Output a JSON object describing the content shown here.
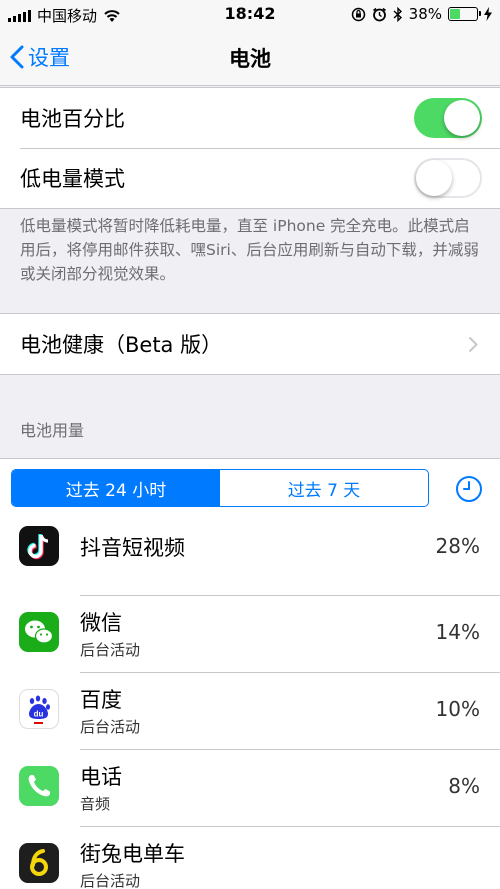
{
  "status_bar": {
    "carrier": "中国移动",
    "time": "18:42",
    "battery_percent": "38%",
    "battery_level": 0.38
  },
  "nav": {
    "back_label": "设置",
    "title": "电池"
  },
  "settings": {
    "battery_percentage_label": "电池百分比",
    "battery_percentage_on": true,
    "low_power_label": "低电量模式",
    "low_power_on": false,
    "low_power_footnote": "低电量模式将暂时降低耗电量，直至 iPhone 完全充电。此模式启用后，将停用邮件获取、嘿Siri、后台应用刷新与自动下载，并减弱或关闭部分视觉效果。",
    "battery_health_label": "电池健康（Beta 版）"
  },
  "usage": {
    "section_header": "电池用量",
    "segments": [
      "过去 24 小时",
      "过去 7 天"
    ],
    "selected_segment": 0,
    "apps": [
      {
        "name": "抖音短视频",
        "subtitle": "",
        "percent": "28%",
        "icon": "douyin-icon"
      },
      {
        "name": "微信",
        "subtitle": "后台活动",
        "percent": "14%",
        "icon": "wechat-icon"
      },
      {
        "name": "百度",
        "subtitle": "后台活动",
        "percent": "10%",
        "icon": "baidu-icon"
      },
      {
        "name": "电话",
        "subtitle": "音频",
        "percent": "8%",
        "icon": "phone-icon"
      },
      {
        "name": "街兔电单车",
        "subtitle": "后台活动",
        "percent": "",
        "icon": "jietu-icon"
      }
    ]
  },
  "colors": {
    "ios_blue": "#007aff",
    "toggle_green": "#4cd964",
    "wechat_green": "#1aad19",
    "phone_green": "#4cd964"
  }
}
